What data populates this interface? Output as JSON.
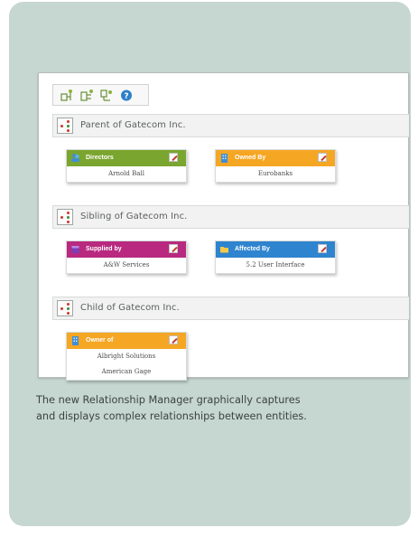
{
  "toolbar": {
    "buttons": [
      {
        "icon": "add-parent-icon"
      },
      {
        "icon": "add-sibling-icon"
      },
      {
        "icon": "add-child-icon"
      },
      {
        "icon": "help-icon"
      }
    ]
  },
  "sections": [
    {
      "title": "Parent of Gatecom Inc."
    },
    {
      "title": "Sibling of Gatecom Inc."
    },
    {
      "title": "Child of Gatecom Inc."
    }
  ],
  "cards": [
    {
      "title": "Directors",
      "color": "#7aa52f",
      "icon": "people-icon",
      "items": [
        "Arnold Ball"
      ]
    },
    {
      "title": "Owned By",
      "color": "#f5a623",
      "icon": "building-icon",
      "items": [
        "Eurobanks"
      ]
    },
    {
      "title": "Supplied by",
      "color": "#b8297f",
      "icon": "box-icon",
      "items": [
        "A&W Services"
      ]
    },
    {
      "title": "Affected By",
      "color": "#2f84cf",
      "icon": "folder-icon",
      "items": [
        "5.2 User Interface"
      ]
    },
    {
      "title": "Owner of",
      "color": "#f5a623",
      "icon": "building-icon",
      "items": [
        "Albright Solutions",
        "American Gage"
      ]
    }
  ],
  "caption": {
    "line1": "The new Relationship Manager graphically captures",
    "line2": "and displays complex relationships between entities."
  }
}
